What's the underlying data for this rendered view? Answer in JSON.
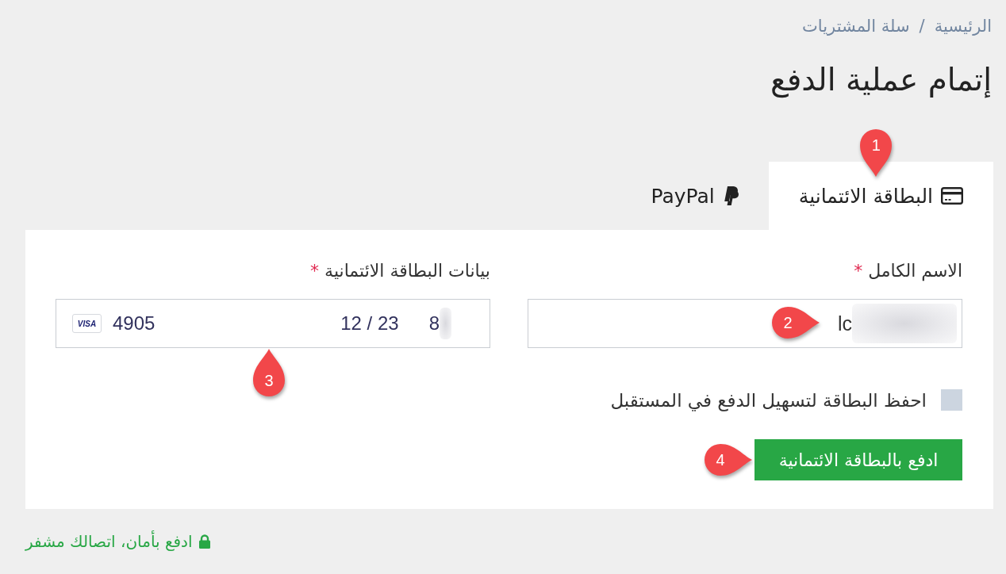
{
  "breadcrumb": {
    "items": [
      {
        "label": "الرئيسية"
      },
      {
        "label": "سلة المشتريات"
      }
    ],
    "separator": "/"
  },
  "title": "إتمام عملية الدفع",
  "tabs": [
    {
      "label": "البطاقة الائتمانية",
      "kind": "card",
      "selected": true,
      "marker": {
        "label": "1",
        "kind": "down"
      }
    },
    {
      "label": "PayPal",
      "kind": "paypal",
      "selected": false
    }
  ],
  "form": {
    "fields": [
      {
        "kind": "name",
        "label": "الاسم الكامل",
        "required_mark": "*",
        "value": "lc",
        "redacted": true,
        "marker": {
          "label": "2",
          "kind": "right"
        }
      },
      {
        "kind": "card",
        "label": "بيانات البطاقة الائتمانية",
        "required_mark": "*",
        "brand": "VISA",
        "number": "4905",
        "expiry": "12 / 23",
        "cvc": "8",
        "redacted": true,
        "marker": {
          "label": "3",
          "kind": "up"
        }
      }
    ],
    "save_card": {
      "label": "احفظ البطاقة لتسهيل الدفع في المستقبل",
      "checked": false
    },
    "submit": {
      "label": "ادفع بالبطاقة الائتمانية",
      "marker": {
        "label": "4",
        "kind": "right"
      }
    }
  },
  "secure_note": "ادفع بأمان، اتصالك مشفر"
}
